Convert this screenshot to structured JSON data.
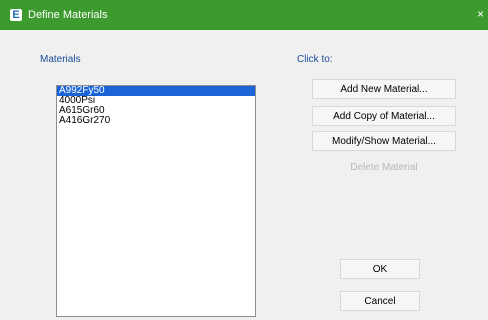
{
  "window": {
    "title": "Define Materials",
    "app_icon_letter": "E",
    "close_glyph": "×",
    "titlebar_color": "#3d9a2e"
  },
  "materials_group": {
    "label": "Materials",
    "items": [
      {
        "label": "A992Fy50",
        "selected": true
      },
      {
        "label": "4000Psi",
        "selected": false
      },
      {
        "label": "A615Gr60",
        "selected": false
      },
      {
        "label": "A416Gr270",
        "selected": false
      }
    ]
  },
  "click_to_group": {
    "label": "Click to:",
    "add_new": "Add New Material...",
    "add_copy": "Add Copy of Material...",
    "modify_show": "Modify/Show Material...",
    "delete": "Delete Material"
  },
  "footer": {
    "ok": "OK",
    "cancel": "Cancel"
  }
}
